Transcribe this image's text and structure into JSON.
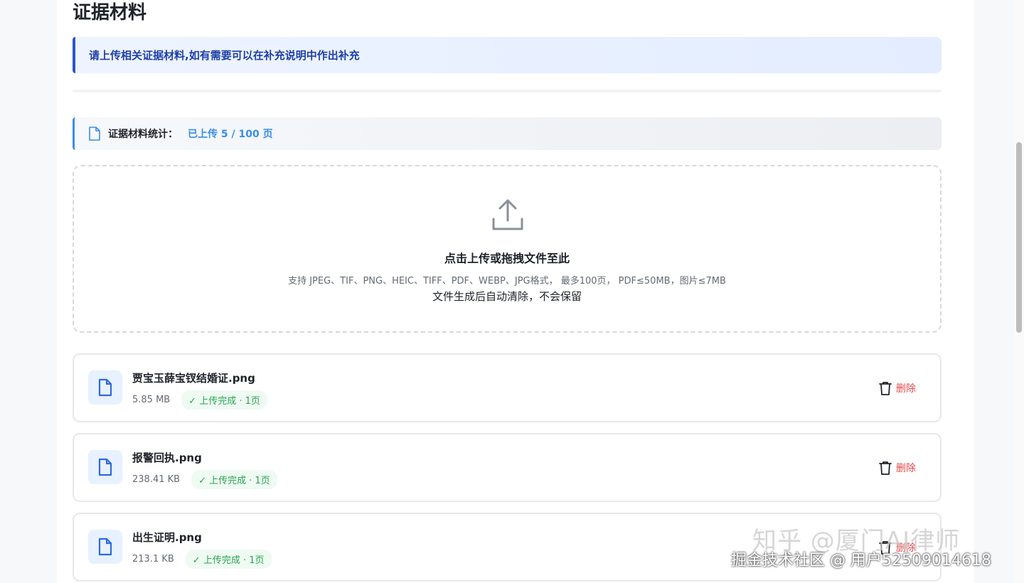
{
  "page_title": "证据材料",
  "notice": "请上传相关证据材料,如有需要可以在补充说明中作出补充",
  "stats": {
    "label": "证据材料统计：",
    "value": "已上传 5 / 100 页"
  },
  "dropzone": {
    "title": "点击上传或拖拽文件至此",
    "formats": "支持 JPEG、TIF、PNG、HEIC、TIFF、PDF、WEBP、JPG格式， 最多100页， PDF≤50MB，图片≤7MB",
    "note": "文件生成后自动清除，不会保留"
  },
  "files": [
    {
      "name": "贾宝玉薛宝钗结婚证.png",
      "size": "5.85 MB",
      "status": "✓ 上传完成 · 1页",
      "delete_label": "删除"
    },
    {
      "name": "报警回执.png",
      "size": "238.41 KB",
      "status": "✓ 上传完成 · 1页",
      "delete_label": "删除"
    },
    {
      "name": "出生证明.png",
      "size": "213.1 KB",
      "status": "✓ 上传完成 · 1页",
      "delete_label": "删除"
    }
  ],
  "watermark": {
    "line1": "知乎 @厦门AI律师",
    "line2": "掘金技术社区 @ 用户52509014618"
  },
  "colors": {
    "accent": "#2f54c8",
    "stats_accent": "#3a8ee6",
    "success": "#2ba353",
    "danger": "#e5484d"
  },
  "icons": {
    "stats": "document-icon",
    "dropzone": "upload-icon",
    "file": "file-icon",
    "delete": "trash-icon"
  }
}
